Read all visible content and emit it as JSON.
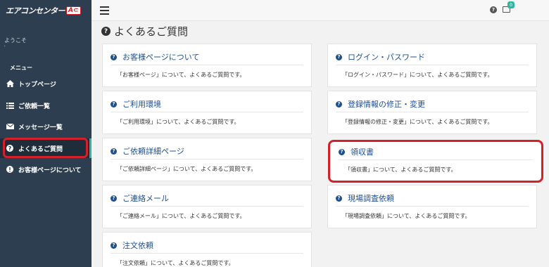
{
  "header": {
    "logo_text": "エアコンセンター",
    "logo_badge": "A⊂",
    "help_icon": "question-circle-icon",
    "mail_icon": "envelope-icon",
    "mail_count": "0"
  },
  "sidebar": {
    "welcome": "ようこそ",
    "user_name": "'",
    "menu_heading": "メニュー",
    "items": [
      {
        "label": "トップページ",
        "icon": "home-icon"
      },
      {
        "label": "ご依頼一覧",
        "icon": "list-icon"
      },
      {
        "label": "メッセージ一覧",
        "icon": "envelope-icon"
      },
      {
        "label": "よくあるご質問",
        "icon": "question-circle-icon"
      },
      {
        "label": "お客様ページについて",
        "icon": "info-circle-icon"
      }
    ]
  },
  "page": {
    "title": "よくあるご質問"
  },
  "faq": [
    {
      "title": "お客様ページについて",
      "desc": "「お客様ページ」について、よくあるご質問です。"
    },
    {
      "title": "ログイン・パスワード",
      "desc": "「ログイン・パスワード」について、よくあるご質問です。"
    },
    {
      "title": "ご利用環境",
      "desc": "「ご利用環境」について、よくあるご質問です。"
    },
    {
      "title": "登録情報の修正・変更",
      "desc": "「登録情報の修正・変更」について、よくあるご質問です。"
    },
    {
      "title": "ご依頼詳細ページ",
      "desc": "「ご依頼詳細ページ」について、よくあるご質問です。"
    },
    {
      "title": "領収書",
      "desc": "「領収書」について、よくあるご質問です。"
    },
    {
      "title": "ご連絡メール",
      "desc": "「ご連絡メール」について、よくあるご質問です。"
    },
    {
      "title": "現場調査依頼",
      "desc": "「現場調査依頼」について、よくあるご質問です。"
    },
    {
      "title": "注文依頼",
      "desc": "「注文依頼」について、よくあるご質問です。"
    }
  ],
  "colors": {
    "sidebar_bg": "#2d3e50",
    "link_blue": "#1d4f91",
    "accent_teal": "#2fb5a0",
    "highlight_red": "#d3212b"
  }
}
